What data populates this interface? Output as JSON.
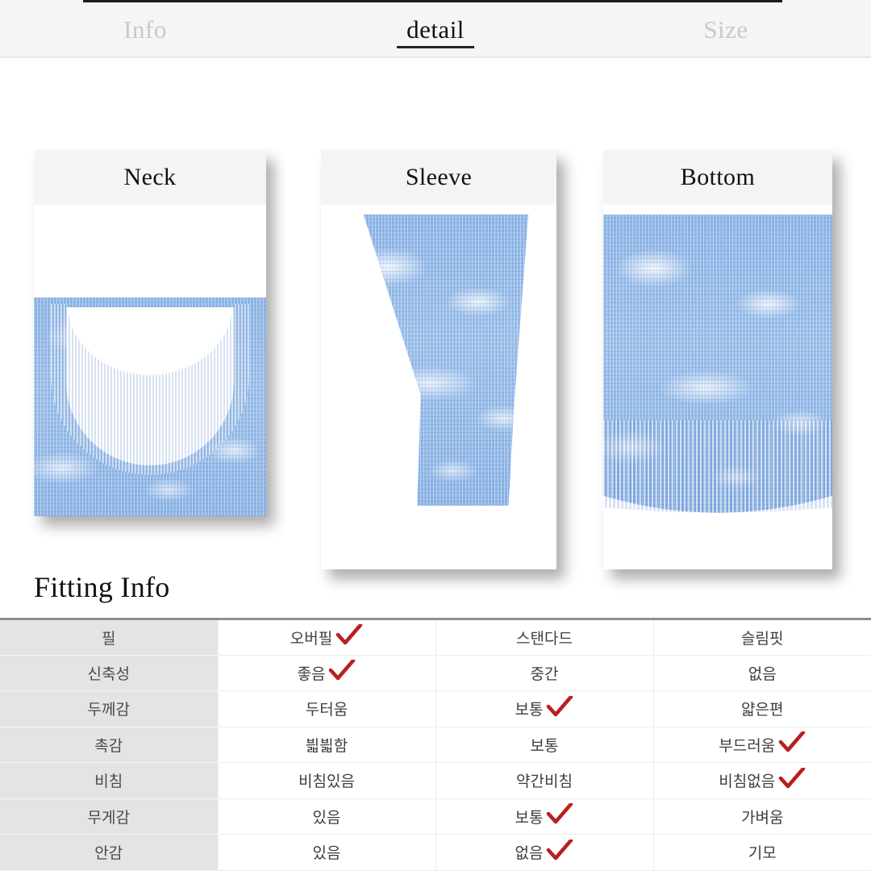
{
  "tabs": [
    {
      "label": "Info",
      "active": false
    },
    {
      "label": "detail",
      "active": true
    },
    {
      "label": "Size",
      "active": false
    }
  ],
  "detail_cards": [
    {
      "title": "Neck",
      "photo": "knit-sweater-neckline-photo"
    },
    {
      "title": "Sleeve",
      "photo": "knit-sweater-sleeve-cuff-photo"
    },
    {
      "title": "Bottom",
      "photo": "knit-sweater-hem-photo"
    }
  ],
  "fitting": {
    "heading": "Fitting Info",
    "check_color": "#b81f1f",
    "rows": [
      {
        "label": "필",
        "options": [
          {
            "text": "오버필",
            "checked": true
          },
          {
            "text": "스탠다드",
            "checked": false
          },
          {
            "text": "슬림핏",
            "checked": false
          }
        ]
      },
      {
        "label": "신축성",
        "options": [
          {
            "text": "좋음",
            "checked": true
          },
          {
            "text": "중간",
            "checked": false
          },
          {
            "text": "없음",
            "checked": false
          }
        ]
      },
      {
        "label": "두께감",
        "options": [
          {
            "text": "두터움",
            "checked": false
          },
          {
            "text": "보통",
            "checked": true
          },
          {
            "text": "얇은편",
            "checked": false
          }
        ]
      },
      {
        "label": "촉감",
        "options": [
          {
            "text": "븳븳함",
            "checked": false
          },
          {
            "text": "보통",
            "checked": false
          },
          {
            "text": "부드러움",
            "checked": true
          }
        ]
      },
      {
        "label": "비침",
        "options": [
          {
            "text": "비침있음",
            "checked": false
          },
          {
            "text": "약간비침",
            "checked": false
          },
          {
            "text": "비침없음",
            "checked": true
          }
        ]
      },
      {
        "label": "무게감",
        "options": [
          {
            "text": "있음",
            "checked": false
          },
          {
            "text": "보통",
            "checked": true
          },
          {
            "text": "가벼움",
            "checked": false
          }
        ]
      },
      {
        "label": "안감",
        "options": [
          {
            "text": "있음",
            "checked": false
          },
          {
            "text": "없음",
            "checked": true
          },
          {
            "text": "기모",
            "checked": false
          }
        ]
      }
    ]
  }
}
